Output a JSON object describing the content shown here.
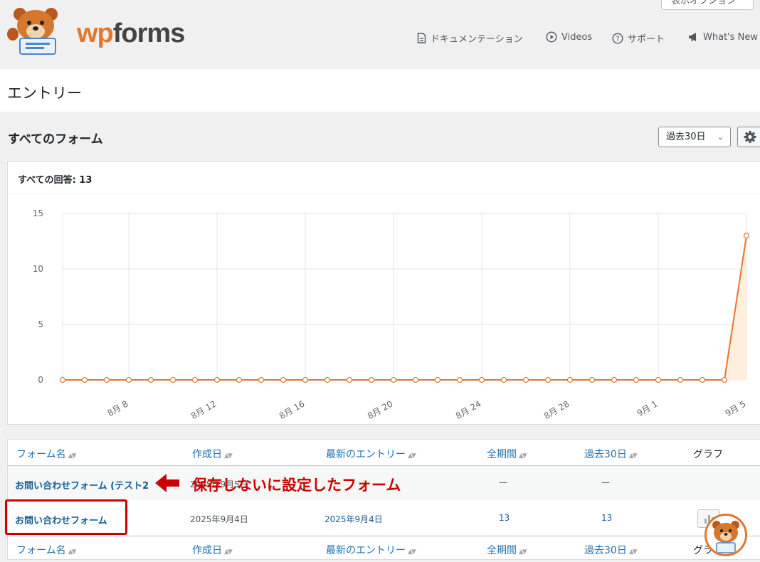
{
  "header": {
    "screen_options": "表示オプション ˅",
    "logo_wp": "wp",
    "logo_forms": "forms",
    "links": {
      "docs": "ドキュメンテーション",
      "videos": "Videos",
      "support": "サポート",
      "whats_new": "What's New"
    }
  },
  "page_title": "エントリー",
  "section_title": "すべてのフォーム",
  "period_select": "過去30日",
  "chart_header": "すべての回答: 13",
  "chart_data": {
    "type": "area",
    "x": [
      "8月5日",
      "8月6日",
      "8月7日",
      "8月8日",
      "8月9日",
      "8月10日",
      "8月11日",
      "8月12日",
      "8月13日",
      "8月14日",
      "8月15日",
      "8月16日",
      "8月17日",
      "8月18日",
      "8月19日",
      "8月20日",
      "8月21日",
      "8月22日",
      "8月23日",
      "8月24日",
      "8月25日",
      "8月26日",
      "8月27日",
      "8月28日",
      "8月29日",
      "8月30日",
      "8月31日",
      "9月1日",
      "9月2日",
      "9月3日",
      "9月4日",
      "9月5日"
    ],
    "values": [
      0,
      0,
      0,
      0,
      0,
      0,
      0,
      0,
      0,
      0,
      0,
      0,
      0,
      0,
      0,
      0,
      0,
      0,
      0,
      0,
      0,
      0,
      0,
      0,
      0,
      0,
      0,
      0,
      0,
      0,
      0,
      13
    ],
    "x_tick_labels": [
      "8月 8",
      "8月 12",
      "8月 16",
      "8月 20",
      "8月 24",
      "8月 28",
      "9月 1",
      "9月 5"
    ],
    "y_ticks": [
      "15",
      "10",
      "5",
      "0"
    ],
    "ylim": [
      0,
      15
    ],
    "grid": true,
    "colors": {
      "line": "#e27730",
      "fill": "#fdeede"
    }
  },
  "table": {
    "headers": [
      "フォーム名",
      "作成日",
      "最新のエントリー",
      "全期間",
      "過去30日",
      "グラフ"
    ],
    "rows": [
      {
        "name": "お問い合わせフォーム (テスト2",
        "created": "2025年9月5日",
        "latest": "",
        "all": "—",
        "last30": "—"
      },
      {
        "name": "お問い合わせフォーム",
        "created": "2025年9月4日",
        "latest": "2025年9月4日",
        "all": "13",
        "last30": "13"
      }
    ]
  },
  "annotation": "保存しないに設定したフォーム"
}
